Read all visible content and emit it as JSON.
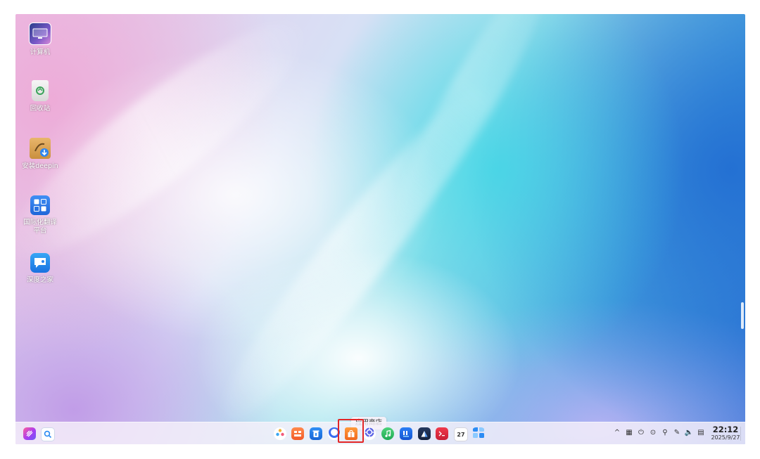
{
  "desktop": {
    "icons": [
      {
        "label": "计算机",
        "icon": "computer-icon"
      },
      {
        "label": "回收站",
        "icon": "trash-icon"
      },
      {
        "label": "安装deepin",
        "icon": "installer-icon"
      },
      {
        "label": "国际化翻译平台",
        "icon": "translate-icon"
      },
      {
        "label": "深度之家",
        "icon": "deepin-home-icon"
      }
    ]
  },
  "tooltip": {
    "text": "应用商店"
  },
  "dock": {
    "left": [
      {
        "icon": "launcher-icon",
        "color": "#b23cf0"
      },
      {
        "icon": "search-icon",
        "color": "#2a8bf2"
      }
    ],
    "apps": [
      {
        "icon": "control-center-icon"
      },
      {
        "icon": "file-manager-icon"
      },
      {
        "icon": "trash-bin-icon"
      },
      {
        "icon": "browser-icon"
      },
      {
        "icon": "app-store-icon"
      },
      {
        "icon": "settings-icon"
      },
      {
        "icon": "music-icon"
      },
      {
        "icon": "notes-icon"
      },
      {
        "icon": "image-viewer-icon"
      },
      {
        "icon": "terminal-icon"
      },
      {
        "icon": "calendar-icon",
        "text": "27"
      },
      {
        "icon": "app-grid-icon"
      }
    ],
    "tray": [
      {
        "icon": "chevron-up-icon",
        "glyph": "^"
      },
      {
        "icon": "keyboard-icon",
        "glyph": "▦"
      },
      {
        "icon": "power-icon",
        "glyph": "⏻"
      },
      {
        "icon": "media-icon",
        "glyph": "⊙"
      },
      {
        "icon": "usb-icon",
        "glyph": "⚲"
      },
      {
        "icon": "pen-icon",
        "glyph": "✎"
      },
      {
        "icon": "volume-icon",
        "glyph": "🔈"
      },
      {
        "icon": "network-icon",
        "glyph": "▤"
      }
    ],
    "clock": {
      "time": "22:12",
      "date": "2025/9/27"
    }
  }
}
